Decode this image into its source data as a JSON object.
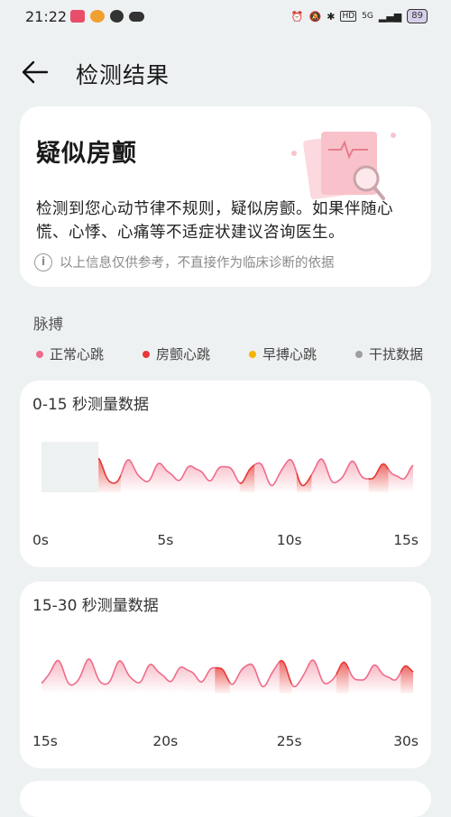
{
  "status_bar": {
    "time": "21:22",
    "battery": "89",
    "network": "5G",
    "left_icons": [
      "app-notification-icon",
      "heart-app-icon",
      "weibo-icon",
      "cloud-icon"
    ],
    "right_icons": [
      "alarm-icon",
      "mute-icon",
      "bluetooth-icon",
      "hd-icon",
      "signal-icon",
      "battery-icon"
    ]
  },
  "header": {
    "title": "检测结果",
    "back_icon": "back-arrow-icon"
  },
  "result": {
    "title": "疑似房颤",
    "description": "检测到您心动节律不规则，疑似房颤。如果伴随心慌、心悸、心痛等不适症状建议咨询医生。",
    "disclaimer": "以上信息仅供参考，不直接作为临床诊断的依据"
  },
  "section": {
    "label": "脉搏"
  },
  "legend": [
    {
      "label": "正常心跳",
      "color": "#ef6b8a"
    },
    {
      "label": "房颤心跳",
      "color": "#e53935"
    },
    {
      "label": "早搏心跳",
      "color": "#f5b400"
    },
    {
      "label": "干扰数据",
      "color": "#9e9e9e"
    }
  ],
  "charts": [
    {
      "title": "0-15 秒测量数据",
      "x_labels": [
        "0s",
        "5s",
        "10s",
        "15s"
      ]
    },
    {
      "title": "15-30 秒测量数据",
      "x_labels": [
        "15s",
        "20s",
        "25s",
        "30s"
      ]
    }
  ],
  "chart_data": [
    {
      "type": "line",
      "title": "0-15 秒测量数据",
      "x_range": [
        0,
        15
      ],
      "x_ticks": [
        "0s",
        "5s",
        "10s",
        "15s"
      ],
      "segments": [
        {
          "type": "interference",
          "from": 0,
          "to": 2.3
        },
        {
          "type": "afib",
          "from": 2.3,
          "to": 3.2
        },
        {
          "type": "normal",
          "from": 3.2,
          "to": 8.0
        },
        {
          "type": "afib",
          "from": 8.0,
          "to": 8.6
        },
        {
          "type": "normal",
          "from": 8.6,
          "to": 10.3
        },
        {
          "type": "afib",
          "from": 10.3,
          "to": 10.9
        },
        {
          "type": "normal",
          "from": 10.9,
          "to": 13.2
        },
        {
          "type": "afib",
          "from": 13.2,
          "to": 14.0
        },
        {
          "type": "normal",
          "from": 14.0,
          "to": 15
        }
      ]
    },
    {
      "type": "line",
      "title": "15-30 秒测量数据",
      "x_range": [
        15,
        30
      ],
      "x_ticks": [
        "15s",
        "20s",
        "25s",
        "30s"
      ],
      "segments": [
        {
          "type": "normal",
          "from": 15,
          "to": 22.0
        },
        {
          "type": "afib",
          "from": 22.0,
          "to": 22.6
        },
        {
          "type": "normal",
          "from": 22.6,
          "to": 24.6
        },
        {
          "type": "afib",
          "from": 24.6,
          "to": 25.1
        },
        {
          "type": "normal",
          "from": 25.1,
          "to": 26.9
        },
        {
          "type": "afib",
          "from": 26.9,
          "to": 27.4
        },
        {
          "type": "normal",
          "from": 27.4,
          "to": 29.5
        },
        {
          "type": "afib",
          "from": 29.5,
          "to": 30
        }
      ]
    }
  ]
}
